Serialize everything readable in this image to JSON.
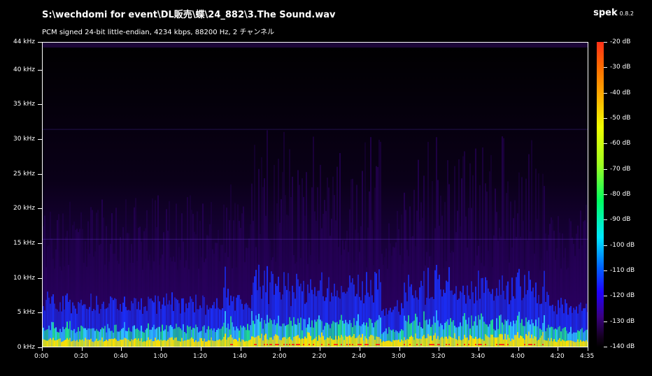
{
  "header": {
    "file_path": "S:\\wechdomi for event\\DL販売\\蝶\\24_882\\3.The Sound.wav",
    "stream_info": "PCM signed 24-bit little-endian, 4234 kbps, 88200 Hz, 2 チャンネル",
    "app_name": "spek",
    "app_version": "0.8.2"
  },
  "frequency_axis": {
    "labels": [
      "0 kHz",
      "5 kHz",
      "10 kHz",
      "15 kHz",
      "20 kHz",
      "25 kHz",
      "30 kHz",
      "35 kHz",
      "40 kHz",
      "44 kHz"
    ],
    "max_khz": 44
  },
  "time_axis": {
    "labels": [
      "0:00",
      "0:20",
      "0:40",
      "1:00",
      "1:20",
      "1:40",
      "2:00",
      "2:20",
      "2:40",
      "3:00",
      "3:20",
      "3:40",
      "4:00",
      "4:20",
      "4:35"
    ],
    "duration_seconds": 275
  },
  "level_scale": {
    "labels": [
      "-20 dB",
      "-30 dB",
      "-40 dB",
      "-50 dB",
      "-60 dB",
      "-70 dB",
      "-80 dB",
      "-90 dB",
      "-100 dB",
      "-110 dB",
      "-120 dB",
      "-130 dB",
      "-140 dB"
    ]
  },
  "colors": {
    "background": "#000000",
    "text": "#ffffff",
    "spectrum_low": "#2a0060",
    "spectrum_mid": "#1a30ff",
    "spectrum_high": "#ffe000",
    "spectrum_peak": "#ff3018"
  }
}
